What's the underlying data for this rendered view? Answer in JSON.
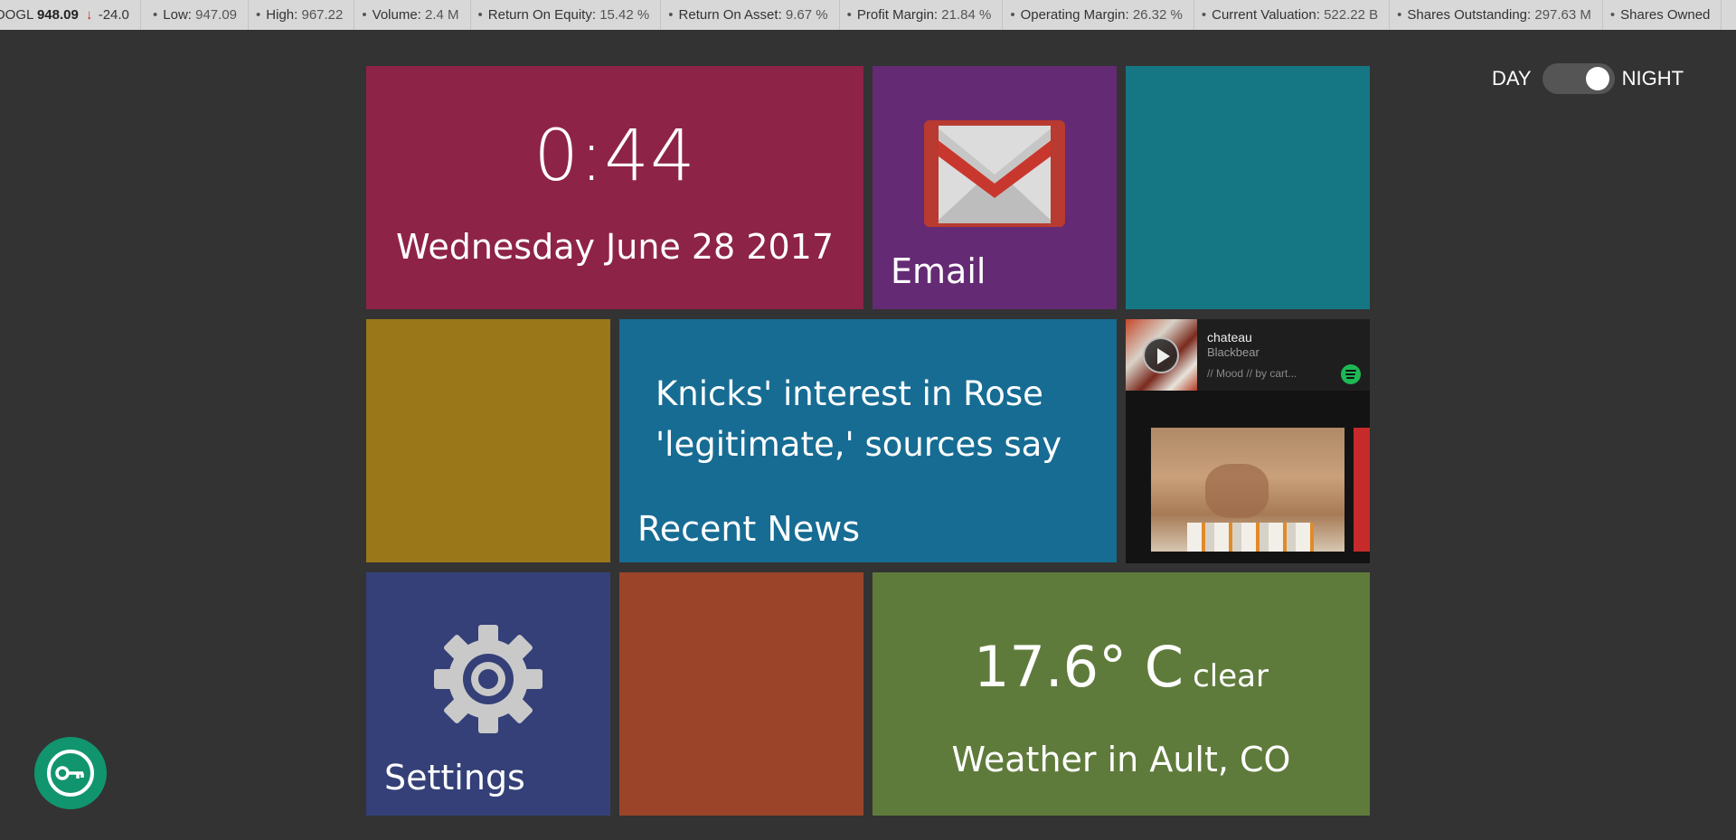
{
  "ticker": {
    "symbol": "OOGL",
    "price": "948.09",
    "change": "-24.0",
    "items": [
      {
        "label": "Low:",
        "value": "947.09"
      },
      {
        "label": "High:",
        "value": "967.22"
      },
      {
        "label": "Volume:",
        "value": "2.4 M"
      },
      {
        "label": "Return On Equity:",
        "value": "15.42 %"
      },
      {
        "label": "Return On Asset:",
        "value": "9.67 %"
      },
      {
        "label": "Profit Margin:",
        "value": "21.84 %"
      },
      {
        "label": "Operating Margin:",
        "value": "26.32 %"
      },
      {
        "label": "Current Valuation:",
        "value": "522.22 B"
      },
      {
        "label": "Shares Outstanding:",
        "value": "297.63 M"
      },
      {
        "label": "Shares Owned",
        "value": ""
      }
    ]
  },
  "theme_toggle": {
    "left_label": "DAY",
    "right_label": "NIGHT",
    "state": "night"
  },
  "clock": {
    "time": "0:44",
    "date": "Wednesday June 28 2017"
  },
  "email": {
    "title": "Email",
    "icon": "gmail-icon"
  },
  "news": {
    "headline": "Knicks' interest in Rose 'legitimate,' sources say",
    "title": "Recent News"
  },
  "music": {
    "song": "chateau",
    "artist": "Blackbear",
    "playlist": "// Mood // by cart...",
    "icon": "spotify-icon"
  },
  "settings": {
    "title": "Settings",
    "icon": "gear-icon"
  },
  "weather": {
    "temp": "17.6° C",
    "condition": "clear",
    "location": "Weather in Ault, CO"
  },
  "colors": {
    "background": "#333333",
    "clock_tile": "#8e2348",
    "email_tile": "#652a74",
    "teal_tile": "#167784",
    "olive_tile": "#9a7719",
    "news_tile": "#176c93",
    "music_tile": "#131313",
    "settings_tile": "#344077",
    "rust_tile": "#9b4429",
    "weather_tile": "#5f7b3b",
    "fab": "#11956f"
  }
}
